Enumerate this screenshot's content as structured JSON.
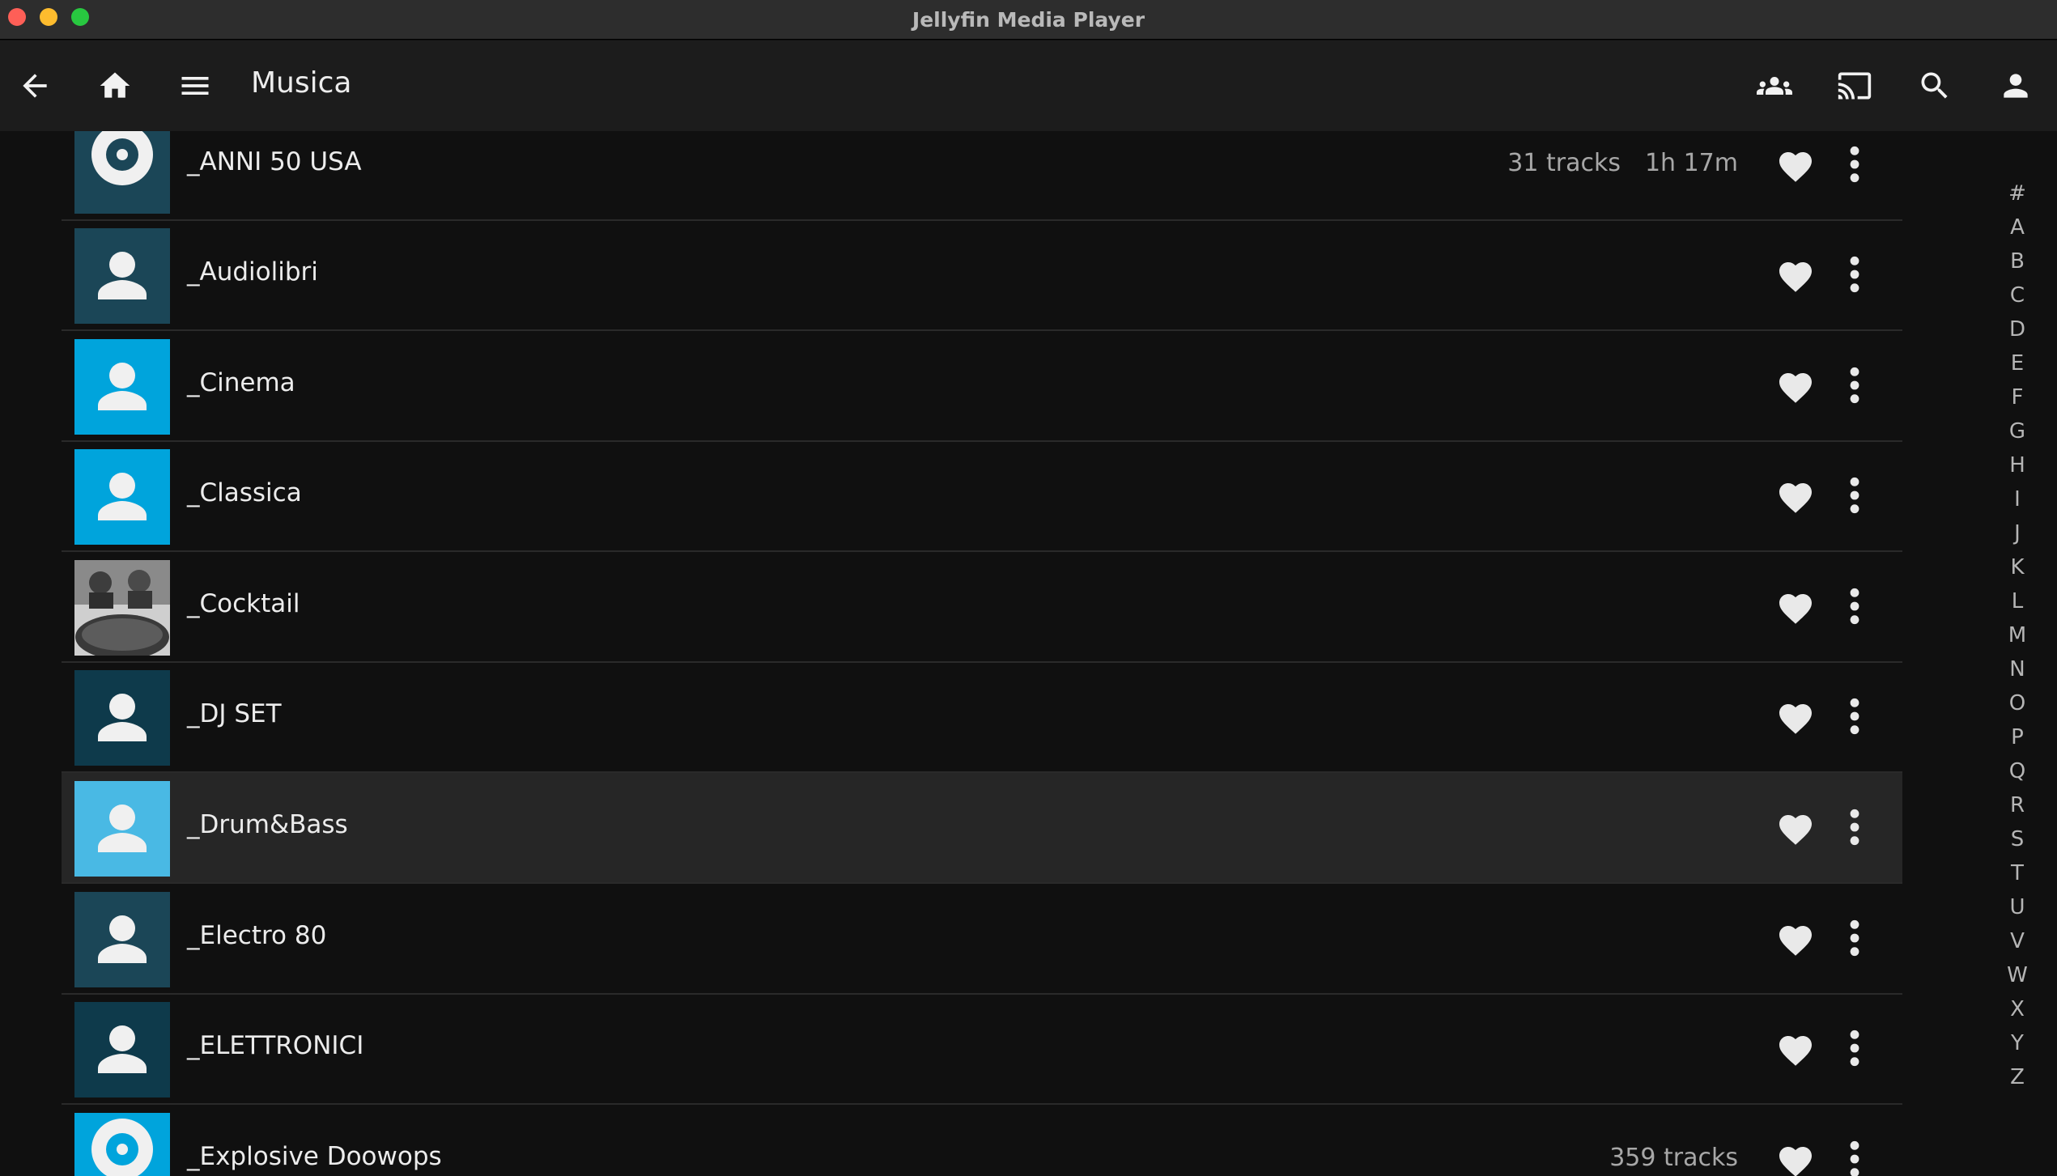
{
  "window": {
    "title": "Jellyfin Media Player"
  },
  "header": {
    "title": "Musica"
  },
  "colors": {
    "tile_blue": "#00a4dc",
    "tile_dark": "#18404f",
    "tile_darker": "#123a4a",
    "background": "#101010"
  },
  "items": [
    {
      "name": "_ANNI 50 USA",
      "tracks": "31 tracks",
      "duration": "1h 17m",
      "thumb": "disc-icon",
      "tile": "#1b4657"
    },
    {
      "name": "_Audiolibri",
      "tracks": "",
      "duration": "",
      "thumb": "person-icon",
      "tile": "#1b4657"
    },
    {
      "name": "_Cinema",
      "tracks": "",
      "duration": "",
      "thumb": "person-icon",
      "tile": "#00a4dc"
    },
    {
      "name": "_Classica",
      "tracks": "",
      "duration": "",
      "thumb": "person-icon",
      "tile": "#00a4dc"
    },
    {
      "name": "_Cocktail",
      "tracks": "",
      "duration": "",
      "thumb": "photo",
      "tile": "#555555"
    },
    {
      "name": "_DJ SET",
      "tracks": "",
      "duration": "",
      "thumb": "person-icon",
      "tile": "#0e3a4b"
    },
    {
      "name": "_Drum&Bass",
      "tracks": "",
      "duration": "",
      "thumb": "person-icon",
      "tile": "#49b9e4"
    },
    {
      "name": "_Electro 80",
      "tracks": "",
      "duration": "",
      "thumb": "person-icon",
      "tile": "#1b4657"
    },
    {
      "name": "_ELETTRONICI",
      "tracks": "",
      "duration": "",
      "thumb": "person-icon",
      "tile": "#0e3a4b"
    },
    {
      "name": "_Explosive Doowops",
      "tracks": "359 tracks",
      "duration": "",
      "thumb": "disc-icon",
      "tile": "#00a4dc"
    }
  ],
  "alphabet": [
    "#",
    "A",
    "B",
    "C",
    "D",
    "E",
    "F",
    "G",
    "H",
    "I",
    "J",
    "K",
    "L",
    "M",
    "N",
    "O",
    "P",
    "Q",
    "R",
    "S",
    "T",
    "U",
    "V",
    "W",
    "X",
    "Y",
    "Z"
  ]
}
